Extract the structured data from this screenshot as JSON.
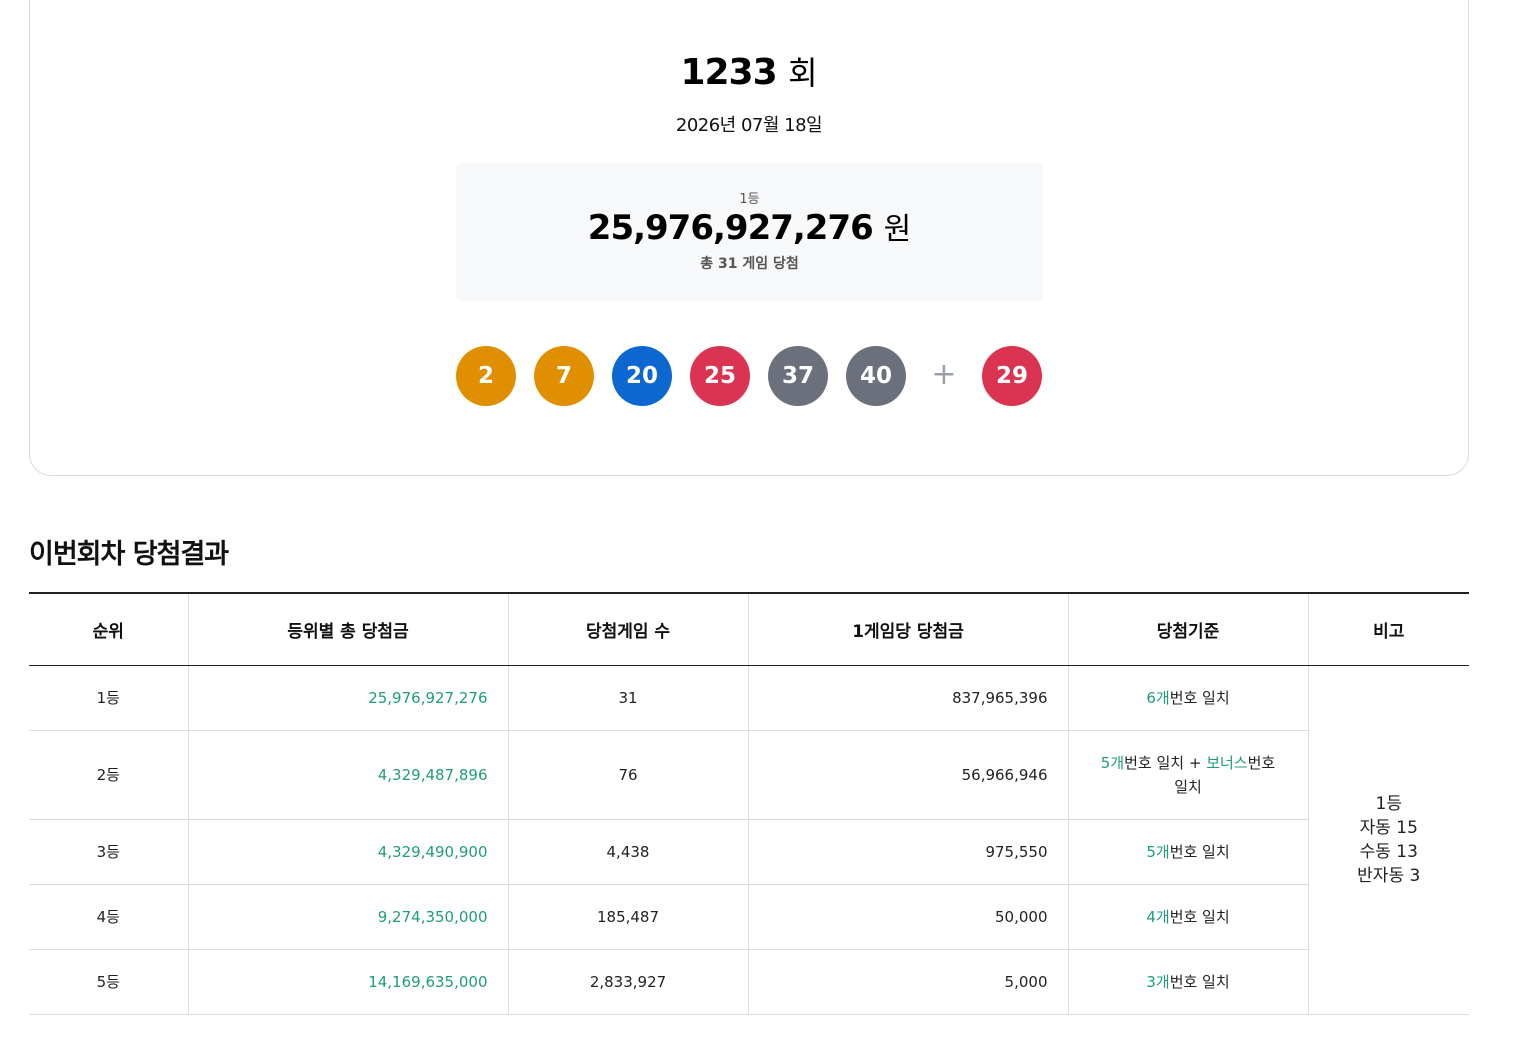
{
  "draw": {
    "round_number": "1233",
    "round_unit": "회",
    "date": "2026년 07월 18일"
  },
  "prize": {
    "rank": "1등",
    "amount": "25,976,927,276",
    "unit": "원",
    "winners_text": "총 31 게임 당첨"
  },
  "balls": [
    {
      "number": "2",
      "color": "#e08f00"
    },
    {
      "number": "7",
      "color": "#e08f00"
    },
    {
      "number": "20",
      "color": "#0d67d1"
    },
    {
      "number": "25",
      "color": "#da3452"
    },
    {
      "number": "37",
      "color": "#6b707c"
    },
    {
      "number": "40",
      "color": "#6b707c"
    }
  ],
  "plus_symbol": "+",
  "bonus_ball": {
    "number": "29",
    "color": "#da3452"
  },
  "results": {
    "title": "이번회차 당첨결과",
    "headers": [
      "순위",
      "등위별 총 당첨금",
      "당첨게임 수",
      "1게임당 당첨금",
      "당첨기준",
      "비고"
    ],
    "rows": [
      {
        "rank": "1등",
        "total": "25,976,927,276",
        "games": "31",
        "per_game": "837,965,396",
        "criteria_count": "6개",
        "criteria_text": "번호 일치"
      },
      {
        "rank": "2등",
        "total": "4,329,487,896",
        "games": "76",
        "per_game": "56,966,946",
        "criteria_count": "5개",
        "criteria_text": "번호 일치 + ",
        "criteria_bonus": "보너스",
        "criteria_bonus_text": "번호 일치"
      },
      {
        "rank": "3등",
        "total": "4,329,490,900",
        "games": "4,438",
        "per_game": "975,550",
        "criteria_count": "5개",
        "criteria_text": "번호 일치"
      },
      {
        "rank": "4등",
        "total": "9,274,350,000",
        "games": "185,487",
        "per_game": "50,000",
        "criteria_count": "4개",
        "criteria_text": "번호 일치"
      },
      {
        "rank": "5등",
        "total": "14,169,635,000",
        "games": "2,833,927",
        "per_game": "5,000",
        "criteria_count": "3개",
        "criteria_text": "번호 일치"
      }
    ],
    "note_lines": [
      "1등",
      "자동 15",
      "수동 13",
      "반자동 3"
    ]
  },
  "accent_color": "#1f9d7a"
}
